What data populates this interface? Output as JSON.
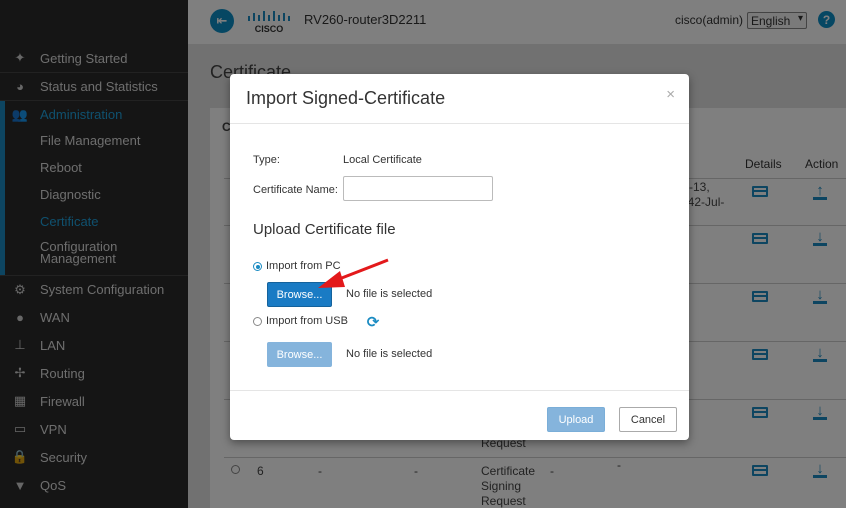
{
  "header": {
    "router_name": "RV260-router3D2211",
    "user": "cisco(admin)",
    "language": "English",
    "help": "?",
    "logo_text": "CISCO"
  },
  "sidebar": {
    "items": [
      {
        "label": "Getting Started",
        "icon": "getting-started-icon"
      },
      {
        "label": "Status and Statistics",
        "icon": "pie-chart-icon"
      },
      {
        "label": "Administration",
        "icon": "users-icon"
      },
      {
        "label": "System Configuration",
        "icon": "gear-icon"
      },
      {
        "label": "WAN",
        "icon": "globe-icon"
      },
      {
        "label": "LAN",
        "icon": "network-icon"
      },
      {
        "label": "Routing",
        "icon": "routing-icon"
      },
      {
        "label": "Firewall",
        "icon": "firewall-icon"
      },
      {
        "label": "VPN",
        "icon": "vpn-icon"
      },
      {
        "label": "Security",
        "icon": "lock-icon"
      },
      {
        "label": "QoS",
        "icon": "filter-icon"
      }
    ],
    "admin_sub": [
      "File Management",
      "Reboot",
      "Diagnostic",
      "Certificate",
      "Configuration",
      "Management"
    ],
    "active_sub": "Certificate"
  },
  "page": {
    "title": "Certificate",
    "panel_head": "C",
    "col_details": "Details",
    "col_action": "Action",
    "row1_text_a": "-13,",
    "row1_text_b": "042-Jul-",
    "row_last_num": "6",
    "row_last_dash1": "-",
    "row_last_dash2": "-",
    "row_last_type_1": "Certificate",
    "row_last_type_2": "Signing",
    "row_last_type_3": "Request",
    "row_last_dash3": "-",
    "row_last_dash4": "-",
    "row_prev_type": "Request"
  },
  "modal": {
    "title": "Import Signed-Certificate",
    "close": "×",
    "type_label": "Type:",
    "type_value": "Local Certificate",
    "cert_name_label": "Certificate Name:",
    "cert_name_value": "",
    "section_title": "Upload Certificate file",
    "import_pc_label": "Import from PC",
    "import_usb_label": "Import from USB",
    "browse_label": "Browse...",
    "no_file": "No file is selected",
    "upload_label": "Upload",
    "cancel_label": "Cancel"
  },
  "colors": {
    "accent": "#1a8bc2",
    "sidebar_bg": "#2b2b2b",
    "arrow": "#e3191b"
  }
}
